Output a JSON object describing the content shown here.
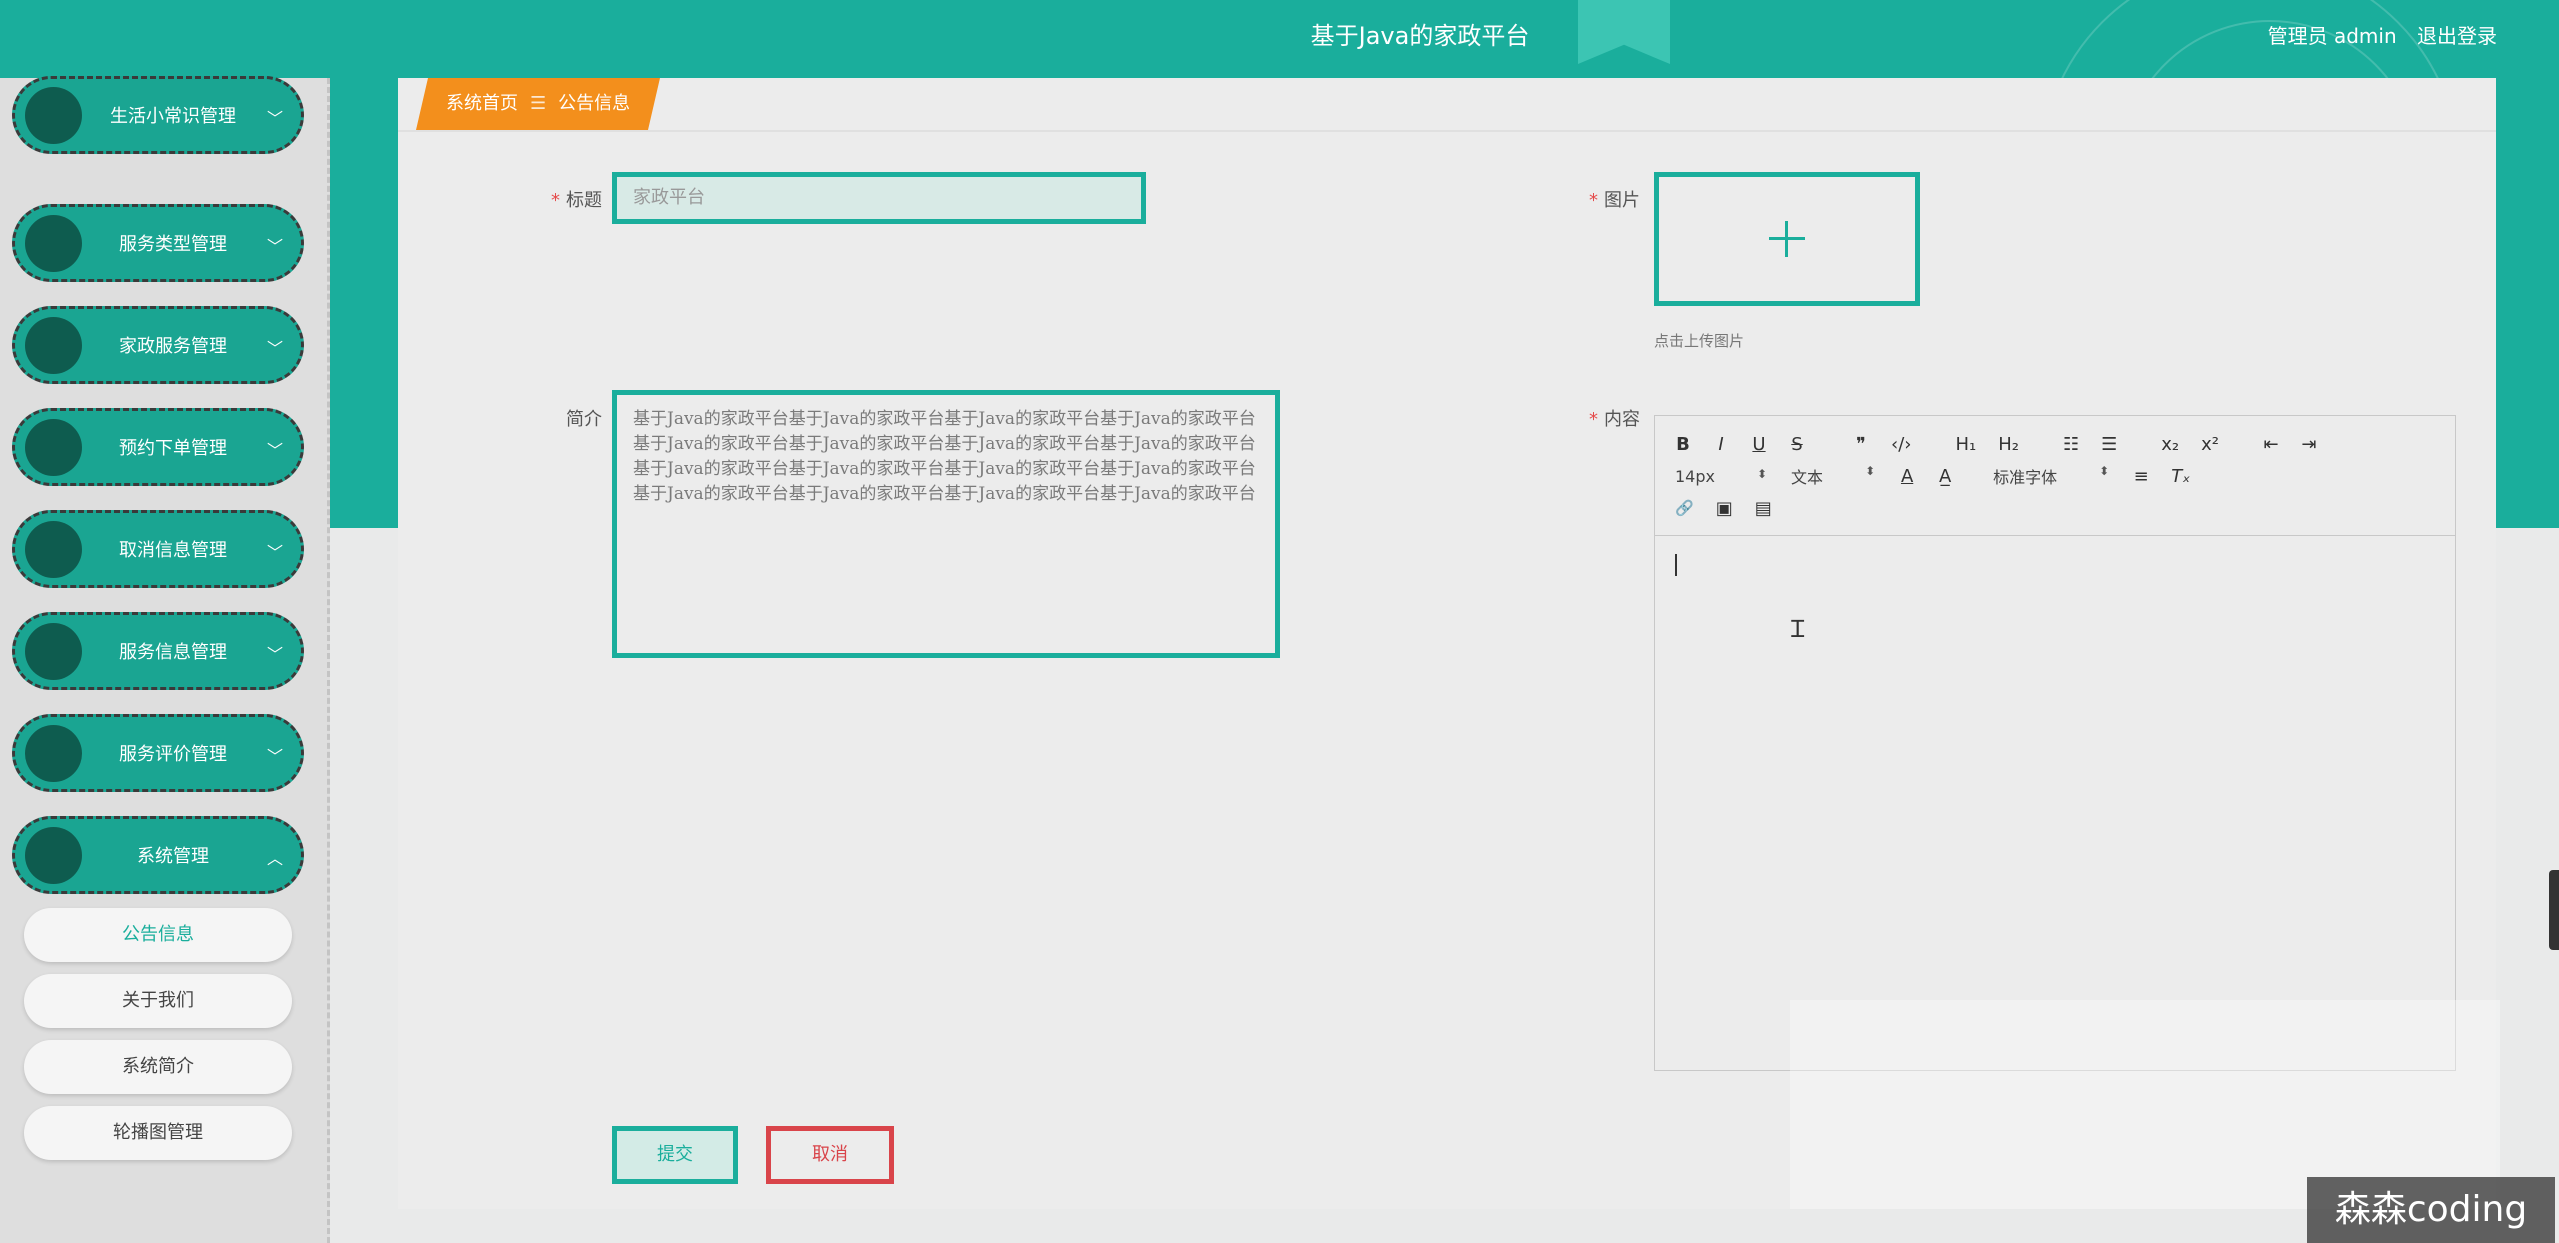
{
  "colors": {
    "accent": "#1aae9c",
    "breadcrumb": "#f38f1c",
    "danger": "#d9444a",
    "menu_dot": "#0e5c4f"
  },
  "header": {
    "title": "基于Java的家政平台",
    "user_label": "管理员 admin",
    "logout_label": "退出登录"
  },
  "sidebar": {
    "menus": [
      {
        "label": "生活小常识管理",
        "icon": "chevron-down-icon"
      },
      {
        "label": "服务类型管理",
        "icon": "chevron-down-icon"
      },
      {
        "label": "家政服务管理",
        "icon": "chevron-down-icon"
      },
      {
        "label": "预约下单管理",
        "icon": "chevron-down-icon"
      },
      {
        "label": "取消信息管理",
        "icon": "chevron-down-icon"
      },
      {
        "label": "服务信息管理",
        "icon": "chevron-down-icon"
      },
      {
        "label": "服务评价管理",
        "icon": "chevron-down-icon"
      },
      {
        "label": "系统管理",
        "icon": "chevron-up-icon"
      }
    ],
    "sub_items": [
      {
        "label": "公告信息",
        "active": true
      },
      {
        "label": "关于我们",
        "active": false
      },
      {
        "label": "系统简介",
        "active": false
      },
      {
        "label": "轮播图管理",
        "active": false
      }
    ]
  },
  "breadcrumb": {
    "home": "系统首页",
    "separator": "☰",
    "current": "公告信息"
  },
  "form": {
    "title_label": "标题",
    "title_value": "家政平台",
    "image_label": "图片",
    "upload_hint": "点击上传图片",
    "intro_label": "简介",
    "intro_value": "基于Java的家政平台基于Java的家政平台基于Java的家政平台基于Java的家政平台基于Java的家政平台基于Java的家政平台基于Java的家政平台基于Java的家政平台基于Java的家政平台基于Java的家政平台基于Java的家政平台基于Java的家政平台基于Java的家政平台基于Java的家政平台基于Java的家政平台基于Java的家政平台",
    "content_label": "内容",
    "submit_label": "提交",
    "cancel_label": "取消"
  },
  "editor": {
    "font_size": "14px",
    "header_select": "文本",
    "font_family": "标准字体",
    "select_arrows": "⬍",
    "buttons_row1": [
      "B",
      "I",
      "U",
      "S",
      "❞",
      "‹/›",
      "H₁",
      "H₂",
      "☷",
      "☰",
      "x₂",
      "x²",
      "⇤",
      "⇥"
    ],
    "buttons_row2_extra": [
      "A",
      "A̲",
      "≡",
      "Tₓ"
    ],
    "buttons_row3": [
      "🔗",
      "▣",
      "▤"
    ]
  },
  "watermark": "森森coding"
}
